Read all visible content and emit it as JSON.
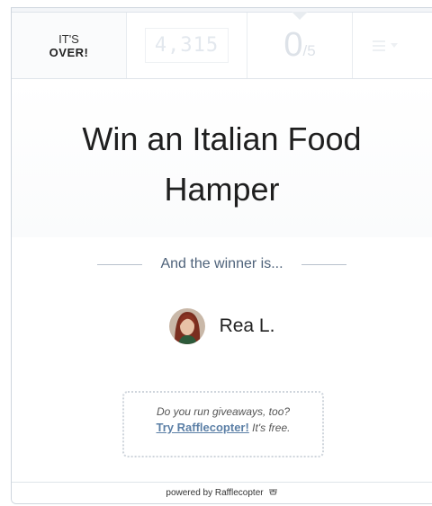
{
  "header": {
    "status_top": "IT'S",
    "status_bottom": "OVER!",
    "entries_total": "4,315",
    "user_entries": "0",
    "user_entries_max": "/5"
  },
  "title": "Win an Italian Food Hamper",
  "winner": {
    "heading": "And the winner is...",
    "name": "Rea L."
  },
  "promo": {
    "line1": "Do you run giveaways, too?",
    "link": "Try Rafflecopter!",
    "suffix": " It's free."
  },
  "footer": {
    "text": "powered by Rafflecopter",
    "icon": "rafflecopter-logo-icon"
  }
}
